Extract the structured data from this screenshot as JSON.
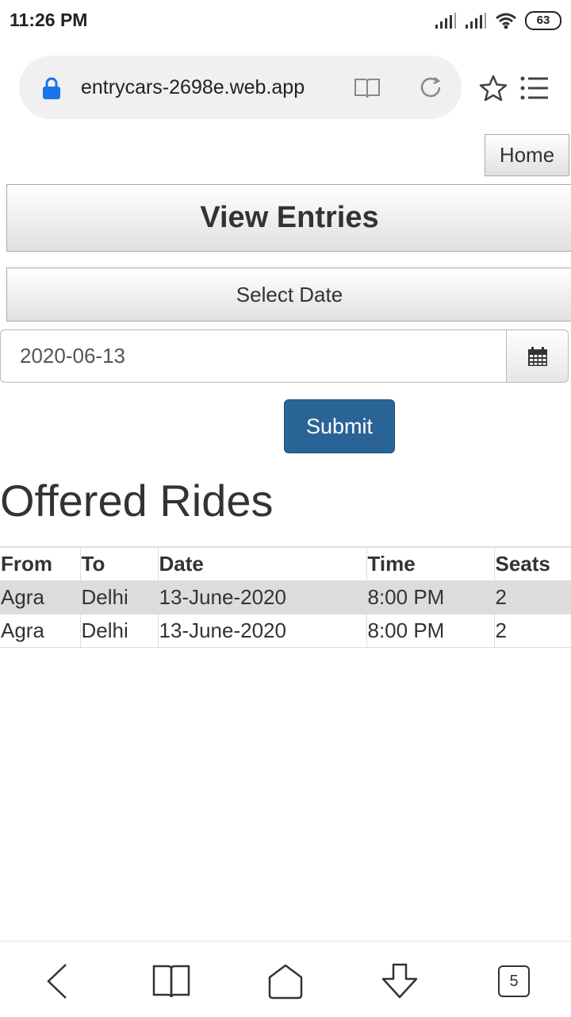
{
  "status_bar": {
    "time": "11:26 PM",
    "battery": "63"
  },
  "browser": {
    "url": "entrycars-2698e.web.app",
    "tab_count": "5"
  },
  "page": {
    "home_label": "Home",
    "view_entries_label": "View Entries",
    "select_date_label": "Select Date",
    "date_value": "2020-06-13",
    "submit_label": "Submit",
    "section_title": "Offered Rides"
  },
  "table": {
    "headers": [
      "From",
      "To",
      "Date",
      "Time",
      "Seats"
    ],
    "rows": [
      [
        "Agra",
        "Delhi",
        "13-June-2020",
        "8:00 PM",
        "2"
      ],
      [
        "Agra",
        "Delhi",
        "13-June-2020",
        "8:00 PM",
        "2"
      ]
    ]
  },
  "colors": {
    "accent": "#2a6496",
    "lock": "#1a73e8"
  }
}
